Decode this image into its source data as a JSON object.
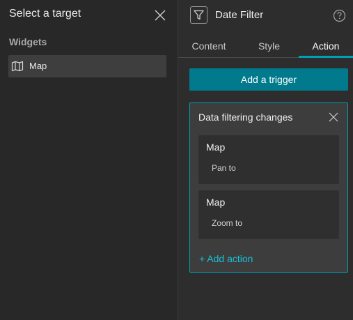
{
  "left_panel": {
    "title": "Select a target",
    "section_label": "Widgets",
    "widgets": [
      {
        "label": "Map",
        "icon": "map-icon"
      }
    ]
  },
  "right_panel": {
    "title": "Date Filter",
    "tabs": [
      {
        "label": "Content"
      },
      {
        "label": "Style"
      },
      {
        "label": "Action"
      }
    ],
    "active_tab": "Action",
    "add_trigger_label": "Add a trigger",
    "trigger": {
      "title": "Data filtering changes",
      "actions": [
        {
          "target": "Map",
          "action": "Pan to"
        },
        {
          "target": "Map",
          "action": "Zoom to"
        }
      ],
      "add_action_label": "+ Add action"
    }
  },
  "colors": {
    "accent": "#00a0b4",
    "button": "#007a8c",
    "link": "#16c3d8",
    "background": "#282828"
  }
}
